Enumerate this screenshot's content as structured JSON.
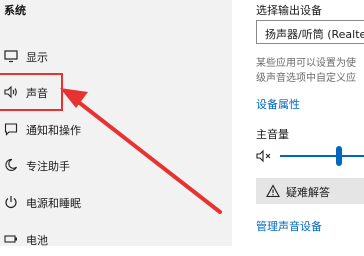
{
  "sidebar": {
    "section_title": "系统",
    "items": [
      {
        "label": "显示",
        "icon": "monitor-icon"
      },
      {
        "label": "声音",
        "icon": "speaker-icon"
      },
      {
        "label": "通知和操作",
        "icon": "notification-icon"
      },
      {
        "label": "专注助手",
        "icon": "moon-icon"
      },
      {
        "label": "电源和睡眠",
        "icon": "power-icon"
      },
      {
        "label": "电池",
        "icon": "battery-icon"
      }
    ]
  },
  "main": {
    "output_device_label": "选择输出设备",
    "output_device_value": "扬声器/听筒 (Realtek",
    "description_line1": "某些应用可以设置为使",
    "description_line2": "级声音选项中自定义应",
    "device_properties_link": "设备属性",
    "master_volume_label": "主音量",
    "master_volume_level": 0.65,
    "troubleshoot_button": "疑难解答",
    "manage_devices_link": "管理声音设备"
  },
  "colors": {
    "accent": "#0067c0",
    "annotation": "#e83232"
  }
}
